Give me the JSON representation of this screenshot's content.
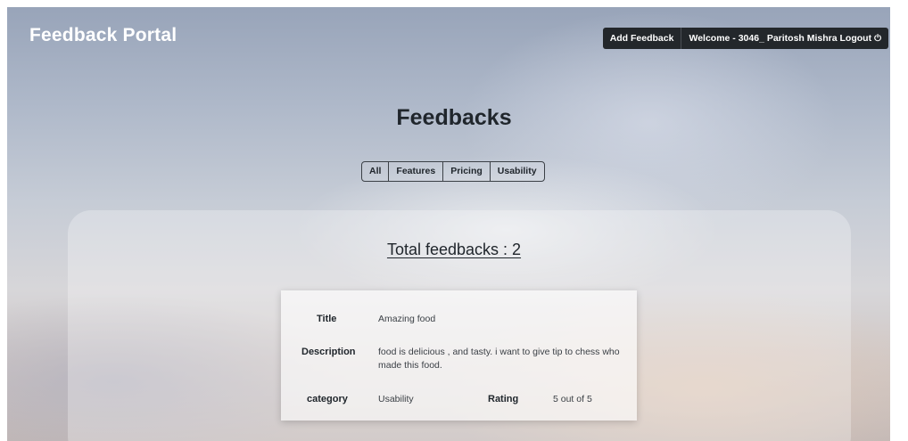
{
  "header": {
    "brand": "Feedback Portal",
    "add_feedback_label": "Add Feedback",
    "welcome_label": "Welcome - 3046_ Paritosh Mishra Logout",
    "logout_icon": "power-icon"
  },
  "main": {
    "title": "Feedbacks",
    "filters": [
      "All",
      "Features",
      "Pricing",
      "Usability"
    ],
    "total_label": "Total feedbacks : 2"
  },
  "feedback": {
    "title_label": "Title",
    "title_value": "Amazing food",
    "description_label": "Description",
    "description_value": "food is delicious , and tasty. i want to give tip to chess who made this food.",
    "category_label": "category",
    "category_value": "Usability",
    "rating_label": "Rating",
    "rating_value": "5 out of 5"
  },
  "colors": {
    "navbar": "#23272b",
    "text_dark": "#20262c"
  }
}
